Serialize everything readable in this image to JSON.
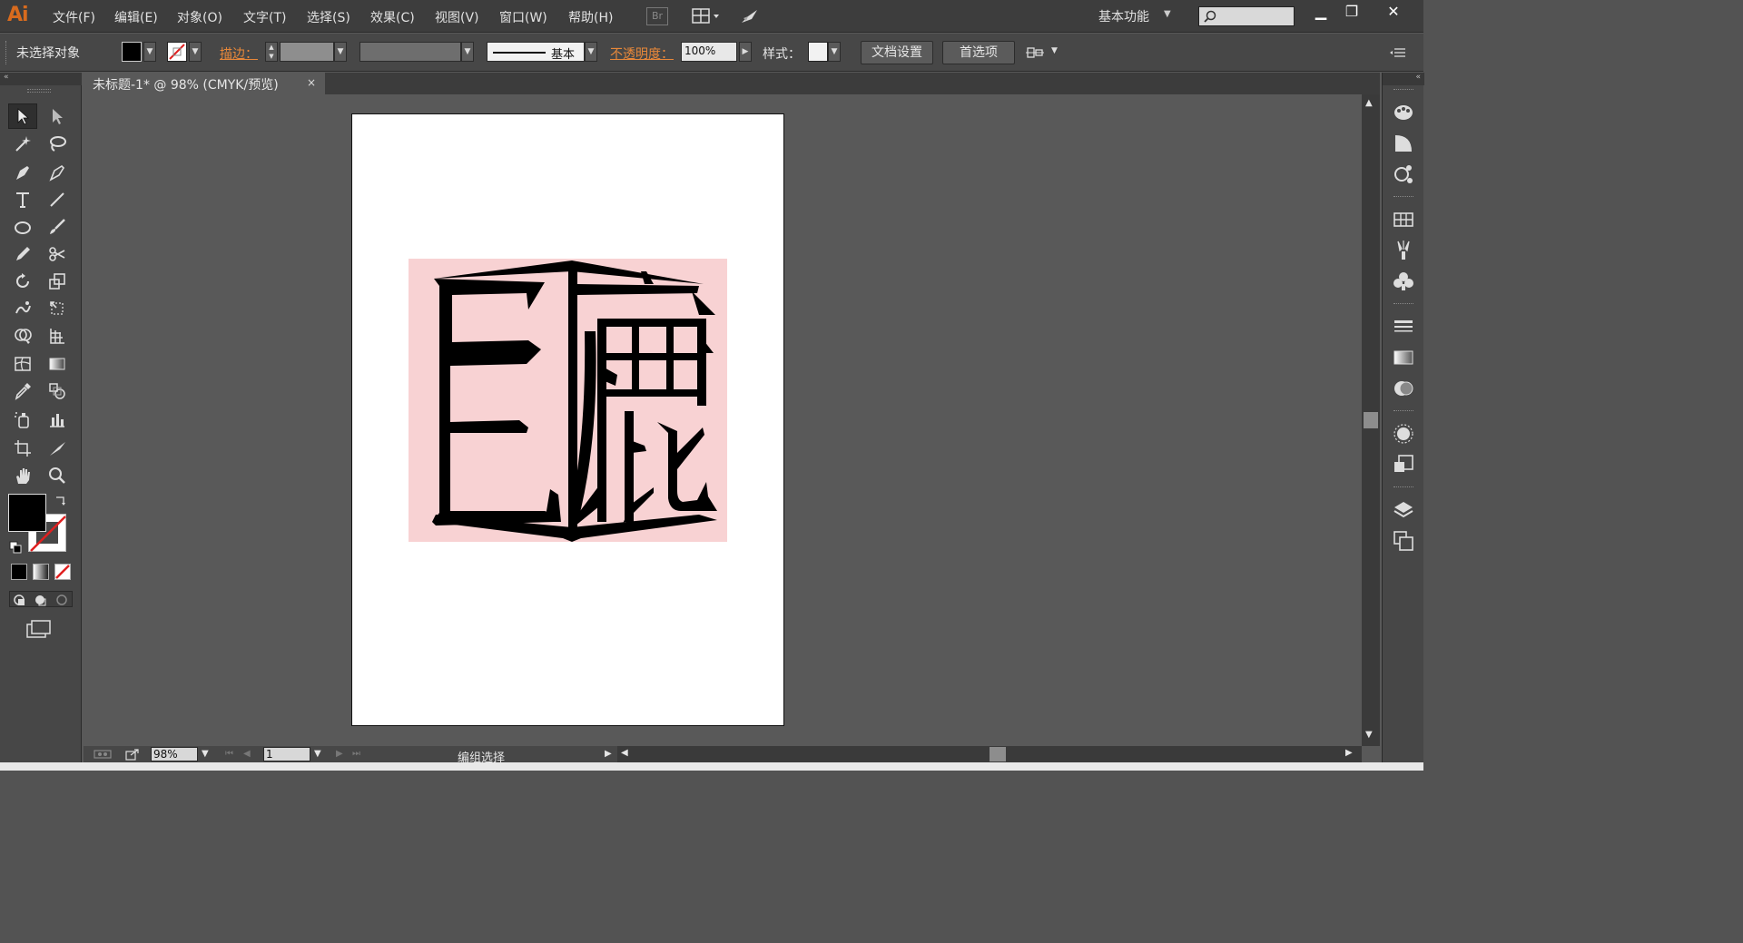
{
  "app": {
    "logo": "Ai"
  },
  "menu": {
    "items": [
      "文件(F)",
      "编辑(E)",
      "对象(O)",
      "文字(T)",
      "选择(S)",
      "效果(C)",
      "视图(V)",
      "窗口(W)",
      "帮助(H)"
    ],
    "bridge_label": "Br",
    "workspace": "基本功能",
    "window_buttons": {
      "minimize": "▁",
      "restore": "❐",
      "close": "✕"
    }
  },
  "control": {
    "no_selection": "未选择对象",
    "stroke_label": "描边：",
    "stroke_style": "基本",
    "opacity_label": "不透明度：",
    "opacity_value": "100%",
    "style_label": "样式：",
    "doc_setup": "文档设置",
    "preferences": "首选项",
    "colors": {
      "fill": "#000000",
      "stroke_none_slash": "#e02020"
    }
  },
  "document": {
    "tab_title": "未标题-1* @ 98% (CMYK/预览)",
    "tab_close": "×",
    "artwork_text": "巨鹿",
    "artwork_bg": "#f8d2d3"
  },
  "statusbar": {
    "zoom": "98%",
    "page": "1",
    "status": "编组选择"
  },
  "icons": {
    "tools": [
      "selection-icon",
      "direct-selection-icon",
      "magic-wand-icon",
      "lasso-icon",
      "pen-icon",
      "curvature-icon",
      "type-icon",
      "line-icon",
      "ellipse-icon",
      "paintbrush-icon",
      "pencil-icon",
      "scissors-icon",
      "rotate-icon",
      "scale-icon",
      "warp-icon",
      "free-transform-icon",
      "shape-builder-icon",
      "perspective-icon",
      "mesh-icon",
      "gradient-icon",
      "eyedropper-icon",
      "blend-icon",
      "symbol-sprayer-icon",
      "graph-icon",
      "artboard-icon",
      "slice-icon",
      "hand-icon",
      "zoom-icon"
    ],
    "dock": [
      "color-icon",
      "color-guide-icon",
      "symbols-icon",
      "swatches-icon",
      "brushes-icon",
      "symbols-club-icon",
      "stroke-icon",
      "gradient-icon",
      "transparency-icon",
      "appearance-icon",
      "graphic-styles-icon",
      "layers-icon",
      "artboards-icon"
    ]
  }
}
